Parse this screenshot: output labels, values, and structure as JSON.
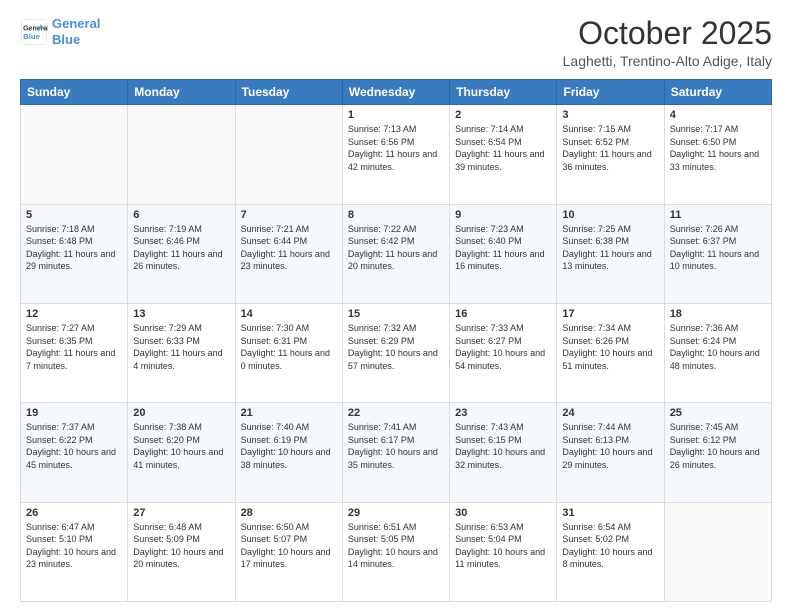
{
  "header": {
    "logo_line1": "General",
    "logo_line2": "Blue",
    "month": "October 2025",
    "location": "Laghetti, Trentino-Alto Adige, Italy"
  },
  "weekdays": [
    "Sunday",
    "Monday",
    "Tuesday",
    "Wednesday",
    "Thursday",
    "Friday",
    "Saturday"
  ],
  "weeks": [
    [
      {
        "day": "",
        "sunrise": "",
        "sunset": "",
        "daylight": ""
      },
      {
        "day": "",
        "sunrise": "",
        "sunset": "",
        "daylight": ""
      },
      {
        "day": "",
        "sunrise": "",
        "sunset": "",
        "daylight": ""
      },
      {
        "day": "1",
        "sunrise": "Sunrise: 7:13 AM",
        "sunset": "Sunset: 6:56 PM",
        "daylight": "Daylight: 11 hours and 42 minutes."
      },
      {
        "day": "2",
        "sunrise": "Sunrise: 7:14 AM",
        "sunset": "Sunset: 6:54 PM",
        "daylight": "Daylight: 11 hours and 39 minutes."
      },
      {
        "day": "3",
        "sunrise": "Sunrise: 7:15 AM",
        "sunset": "Sunset: 6:52 PM",
        "daylight": "Daylight: 11 hours and 36 minutes."
      },
      {
        "day": "4",
        "sunrise": "Sunrise: 7:17 AM",
        "sunset": "Sunset: 6:50 PM",
        "daylight": "Daylight: 11 hours and 33 minutes."
      }
    ],
    [
      {
        "day": "5",
        "sunrise": "Sunrise: 7:18 AM",
        "sunset": "Sunset: 6:48 PM",
        "daylight": "Daylight: 11 hours and 29 minutes."
      },
      {
        "day": "6",
        "sunrise": "Sunrise: 7:19 AM",
        "sunset": "Sunset: 6:46 PM",
        "daylight": "Daylight: 11 hours and 26 minutes."
      },
      {
        "day": "7",
        "sunrise": "Sunrise: 7:21 AM",
        "sunset": "Sunset: 6:44 PM",
        "daylight": "Daylight: 11 hours and 23 minutes."
      },
      {
        "day": "8",
        "sunrise": "Sunrise: 7:22 AM",
        "sunset": "Sunset: 6:42 PM",
        "daylight": "Daylight: 11 hours and 20 minutes."
      },
      {
        "day": "9",
        "sunrise": "Sunrise: 7:23 AM",
        "sunset": "Sunset: 6:40 PM",
        "daylight": "Daylight: 11 hours and 16 minutes."
      },
      {
        "day": "10",
        "sunrise": "Sunrise: 7:25 AM",
        "sunset": "Sunset: 6:38 PM",
        "daylight": "Daylight: 11 hours and 13 minutes."
      },
      {
        "day": "11",
        "sunrise": "Sunrise: 7:26 AM",
        "sunset": "Sunset: 6:37 PM",
        "daylight": "Daylight: 11 hours and 10 minutes."
      }
    ],
    [
      {
        "day": "12",
        "sunrise": "Sunrise: 7:27 AM",
        "sunset": "Sunset: 6:35 PM",
        "daylight": "Daylight: 11 hours and 7 minutes."
      },
      {
        "day": "13",
        "sunrise": "Sunrise: 7:29 AM",
        "sunset": "Sunset: 6:33 PM",
        "daylight": "Daylight: 11 hours and 4 minutes."
      },
      {
        "day": "14",
        "sunrise": "Sunrise: 7:30 AM",
        "sunset": "Sunset: 6:31 PM",
        "daylight": "Daylight: 11 hours and 0 minutes."
      },
      {
        "day": "15",
        "sunrise": "Sunrise: 7:32 AM",
        "sunset": "Sunset: 6:29 PM",
        "daylight": "Daylight: 10 hours and 57 minutes."
      },
      {
        "day": "16",
        "sunrise": "Sunrise: 7:33 AM",
        "sunset": "Sunset: 6:27 PM",
        "daylight": "Daylight: 10 hours and 54 minutes."
      },
      {
        "day": "17",
        "sunrise": "Sunrise: 7:34 AM",
        "sunset": "Sunset: 6:26 PM",
        "daylight": "Daylight: 10 hours and 51 minutes."
      },
      {
        "day": "18",
        "sunrise": "Sunrise: 7:36 AM",
        "sunset": "Sunset: 6:24 PM",
        "daylight": "Daylight: 10 hours and 48 minutes."
      }
    ],
    [
      {
        "day": "19",
        "sunrise": "Sunrise: 7:37 AM",
        "sunset": "Sunset: 6:22 PM",
        "daylight": "Daylight: 10 hours and 45 minutes."
      },
      {
        "day": "20",
        "sunrise": "Sunrise: 7:38 AM",
        "sunset": "Sunset: 6:20 PM",
        "daylight": "Daylight: 10 hours and 41 minutes."
      },
      {
        "day": "21",
        "sunrise": "Sunrise: 7:40 AM",
        "sunset": "Sunset: 6:19 PM",
        "daylight": "Daylight: 10 hours and 38 minutes."
      },
      {
        "day": "22",
        "sunrise": "Sunrise: 7:41 AM",
        "sunset": "Sunset: 6:17 PM",
        "daylight": "Daylight: 10 hours and 35 minutes."
      },
      {
        "day": "23",
        "sunrise": "Sunrise: 7:43 AM",
        "sunset": "Sunset: 6:15 PM",
        "daylight": "Daylight: 10 hours and 32 minutes."
      },
      {
        "day": "24",
        "sunrise": "Sunrise: 7:44 AM",
        "sunset": "Sunset: 6:13 PM",
        "daylight": "Daylight: 10 hours and 29 minutes."
      },
      {
        "day": "25",
        "sunrise": "Sunrise: 7:45 AM",
        "sunset": "Sunset: 6:12 PM",
        "daylight": "Daylight: 10 hours and 26 minutes."
      }
    ],
    [
      {
        "day": "26",
        "sunrise": "Sunrise: 6:47 AM",
        "sunset": "Sunset: 5:10 PM",
        "daylight": "Daylight: 10 hours and 23 minutes."
      },
      {
        "day": "27",
        "sunrise": "Sunrise: 6:48 AM",
        "sunset": "Sunset: 5:09 PM",
        "daylight": "Daylight: 10 hours and 20 minutes."
      },
      {
        "day": "28",
        "sunrise": "Sunrise: 6:50 AM",
        "sunset": "Sunset: 5:07 PM",
        "daylight": "Daylight: 10 hours and 17 minutes."
      },
      {
        "day": "29",
        "sunrise": "Sunrise: 6:51 AM",
        "sunset": "Sunset: 5:05 PM",
        "daylight": "Daylight: 10 hours and 14 minutes."
      },
      {
        "day": "30",
        "sunrise": "Sunrise: 6:53 AM",
        "sunset": "Sunset: 5:04 PM",
        "daylight": "Daylight: 10 hours and 11 minutes."
      },
      {
        "day": "31",
        "sunrise": "Sunrise: 6:54 AM",
        "sunset": "Sunset: 5:02 PM",
        "daylight": "Daylight: 10 hours and 8 minutes."
      },
      {
        "day": "",
        "sunrise": "",
        "sunset": "",
        "daylight": ""
      }
    ]
  ]
}
